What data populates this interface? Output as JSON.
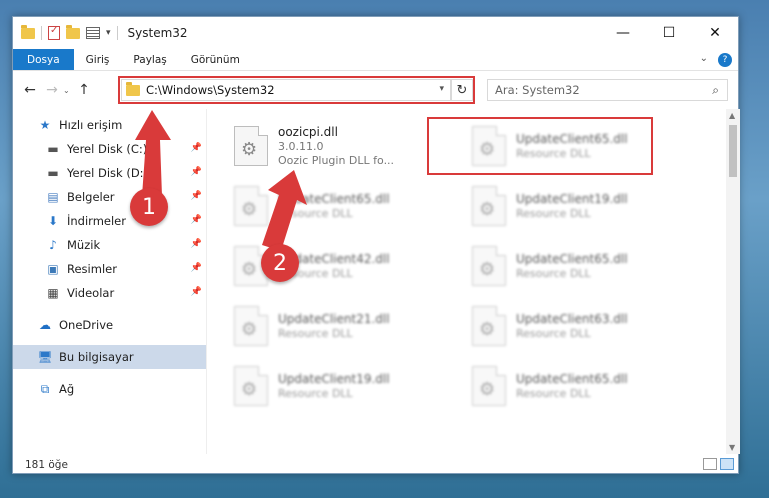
{
  "window": {
    "title": "System32",
    "minimize": "—",
    "maximize": "☐",
    "close": "✕"
  },
  "ribbon": {
    "tabs": [
      "Dosya",
      "Giriş",
      "Paylaş",
      "Görünüm"
    ],
    "expand": "⌄",
    "help": "?"
  },
  "address": {
    "path": "C:\\Windows\\System32",
    "search_placeholder": "Ara: System32"
  },
  "nav": {
    "items": [
      {
        "label": "Hızlı erişim",
        "icon": "star-icon",
        "pinned": false
      },
      {
        "label": "Yerel Disk (C:)",
        "icon": "drive-icon",
        "pinned": true
      },
      {
        "label": "Yerel Disk (D:)",
        "icon": "drive-icon",
        "pinned": true
      },
      {
        "label": "Belgeler",
        "icon": "documents-icon",
        "pinned": true
      },
      {
        "label": "İndirmeler",
        "icon": "download-icon",
        "pinned": true
      },
      {
        "label": "Müzik",
        "icon": "music-icon",
        "pinned": true
      },
      {
        "label": "Resimler",
        "icon": "pictures-icon",
        "pinned": true
      },
      {
        "label": "Videolar",
        "icon": "videos-icon",
        "pinned": true
      },
      {
        "label": "OneDrive",
        "icon": "onedrive-icon",
        "pinned": false
      },
      {
        "label": "Bu bilgisayar",
        "icon": "computer-icon",
        "pinned": false,
        "selected": true
      },
      {
        "label": "Ağ",
        "icon": "network-icon",
        "pinned": false
      }
    ]
  },
  "files": {
    "highlighted": {
      "name": "oozicpi.dll",
      "version": "3.0.11.0",
      "description": "Oozic Plugin DLL fo..."
    },
    "blurred": [
      {
        "name": "UpdateClient65.dll",
        "sub": "Resource DLL"
      },
      {
        "name": "UpdateClient65.dll",
        "sub": "Resource DLL"
      },
      {
        "name": "UpdateClient19.dll",
        "sub": "Resource DLL"
      },
      {
        "name": "UpdateClient42.dll",
        "sub": "Resource DLL"
      },
      {
        "name": "UpdateClient65.dll",
        "sub": "Resource DLL"
      },
      {
        "name": "UpdateClient21.dll",
        "sub": "Resource DLL"
      },
      {
        "name": "UpdateClient63.dll",
        "sub": "Resource DLL"
      },
      {
        "name": "UpdateClient19.dll",
        "sub": "Resource DLL"
      },
      {
        "name": "UpdateClient65.dll",
        "sub": "Resource DLL"
      }
    ]
  },
  "status": {
    "count": "181 öğe"
  },
  "annotations": {
    "step1": "1",
    "step2": "2",
    "color": "#d93a3a"
  }
}
